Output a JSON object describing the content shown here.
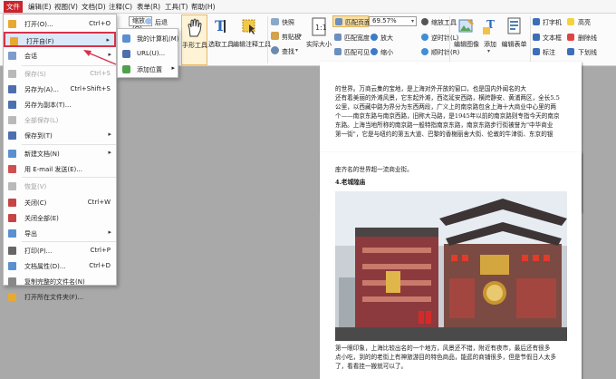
{
  "menubar": {
    "items": [
      "文件",
      "编辑(E)",
      "视图(V)",
      "文档(D)",
      "注释(C)",
      "表单(R)",
      "工具(T)",
      "帮助(H)"
    ]
  },
  "ribbon": {
    "zoom_prev": "缩放(O)",
    "back": "后退",
    "hand_tool": "手形工具",
    "select_text": "选取工具",
    "edit_annot": "编辑注释工具",
    "snapshot": "快照",
    "clipboard": "剪贴板",
    "find": "查找",
    "actual_size": "实际大小",
    "fit_page": "匹配页面",
    "fit_width": "匹配宽度",
    "fit_visible": "匹配可见",
    "zoom_value": "69.57%",
    "zoom_tool": "缩放工具",
    "zoom_in": "放大",
    "zoom_out": "缩小",
    "rotate_left": "逆时针(L)",
    "rotate_right": "顺时针(R)",
    "edit_image": "编辑图像",
    "add": "添加",
    "edit_form": "编辑表单",
    "typewriter": "打字机",
    "textbox": "文本框",
    "note": "标注",
    "highlight": "高亮",
    "strikeout": "删除线",
    "underline": "下划线"
  },
  "file_menu": {
    "items": [
      {
        "label": "打开(O)...",
        "shortcut": "Ctrl+O",
        "arrow": "",
        "enabled": true,
        "icon_color": "#e8a930"
      },
      {
        "label": "打开自(F)",
        "shortcut": "",
        "arrow": "▸",
        "enabled": true,
        "icon_color": "#e8a930"
      },
      {
        "label": "会话",
        "shortcut": "",
        "arrow": "▸",
        "enabled": true,
        "icon_color": "#7c9ccc"
      },
      {
        "label": "保存(S)",
        "shortcut": "Ctrl+S",
        "arrow": "",
        "enabled": false,
        "icon_color": "#b9b9b9"
      },
      {
        "label": "另存为(A)...",
        "shortcut": "Ctrl+Shift+S",
        "arrow": "",
        "enabled": true,
        "icon_color": "#4c6fb0"
      },
      {
        "label": "另存为副本(T)...",
        "shortcut": "",
        "arrow": "",
        "enabled": true,
        "icon_color": "#4c6fb0"
      },
      {
        "label": "全部保存(L)",
        "shortcut": "",
        "arrow": "",
        "enabled": false,
        "icon_color": "#b9b9b9"
      },
      {
        "label": "保存到(T)",
        "shortcut": "",
        "arrow": "▸",
        "enabled": true,
        "icon_color": "#4c6fb0"
      },
      {
        "label": "新建文档(N)",
        "shortcut": "",
        "arrow": "▸",
        "enabled": true,
        "icon_color": "#5a8fd0"
      },
      {
        "label": "用 E-mail 发送(E)...",
        "shortcut": "",
        "arrow": "",
        "enabled": true,
        "icon_color": "#d05050"
      },
      {
        "label": "恢复(V)",
        "shortcut": "",
        "arrow": "",
        "enabled": false,
        "icon_color": "#b9b9b9"
      },
      {
        "label": "关闭(C)",
        "shortcut": "Ctrl+W",
        "arrow": "",
        "enabled": true,
        "icon_color": "#c74444"
      },
      {
        "label": "关闭全部(E)",
        "shortcut": "",
        "arrow": "",
        "enabled": true,
        "icon_color": "#c74444"
      },
      {
        "label": "导出",
        "shortcut": "",
        "arrow": "▸",
        "enabled": true,
        "icon_color": "#5a8fd0"
      },
      {
        "label": "打印(P)...",
        "shortcut": "Ctrl+P",
        "arrow": "",
        "enabled": true,
        "icon_color": "#666666"
      },
      {
        "label": "文档属性(D)...",
        "shortcut": "Ctrl+D",
        "arrow": "",
        "enabled": true,
        "icon_color": "#5a8fd0"
      },
      {
        "label": "复制完整的文件名(N)",
        "shortcut": "",
        "arrow": "",
        "enabled": true,
        "icon_color": "#888888"
      },
      {
        "label": "打开所在文件夹(F)...",
        "shortcut": "",
        "arrow": "",
        "enabled": true,
        "icon_color": "#e8a930"
      }
    ]
  },
  "open_from_submenu": {
    "items": [
      {
        "label": "我的计算机(M)",
        "arrow": "",
        "icon_color": "#5a8fd0"
      },
      {
        "label": "URL(U)...",
        "arrow": "",
        "icon_color": "#4c6fb0"
      },
      {
        "label": "添加位置",
        "arrow": "▸",
        "icon_color": "#4fa24a"
      }
    ]
  },
  "document": {
    "page1_lines": [
      "的世界。万商云集的宝地，是上海对外开放的窗口，也是国内外闻名的大",
      "还有着美丽的外滩风景，它东起外滩，西迄延安西路，横跨静安、黄浦两区，全长5.5",
      "公里，以西藏中路为界分为东西两段，广义上的南京路包含上海十大商业中心里的两",
      "个——南京东路与南京西路，旧称大马路，是1945年以前的南京路则专指今天的南京",
      "东路。上海当地所称的南京路一般特指南京东路，南京东路步行街被誉为\"中华商业",
      "第一街\"，它是与纽约的第五大道、巴黎的香榭丽舍大街、伦敦的牛津街、东京的银"
    ],
    "page2_line1": "座齐名的世界超一流商业街。",
    "page2_heading": "4.老城隍庙",
    "page2_caption_lines": [
      "第一眼印象，上海比较出名的一个地方，风景还不错，附近有夜市，最后还有很多",
      "点小吃，到的的老街上有神旅游目的特色商品，能逛的商铺很多，但是节假日人太多",
      "了，看看挂一搬就可以了。"
    ]
  }
}
